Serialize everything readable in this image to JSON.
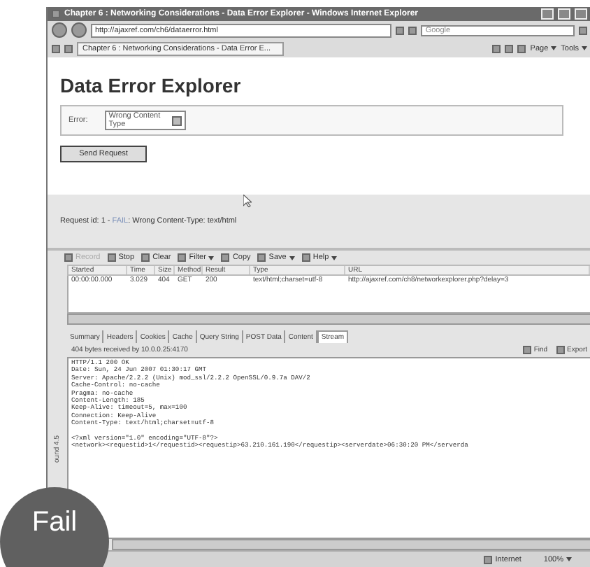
{
  "window": {
    "title": "Chapter 6 : Networking Considerations - Data Error Explorer - Windows Internet Explorer"
  },
  "address_bar": {
    "value": "http://ajaxref.com/ch6/dataerror.html"
  },
  "search": {
    "placeholder": "Google"
  },
  "browser_tab": {
    "label": "Chapter 6 : Networking Considerations - Data Error E..."
  },
  "command_bar": [
    "Page",
    "Tools"
  ],
  "page": {
    "heading": "Data Error Explorer",
    "error_label": "Error:",
    "error_value": "Wrong Content Type",
    "button": "Send Request",
    "status_prefix": "Request id: 1 - ",
    "status_fail": "FAIL",
    "status_suffix": ": Wrong Content-Type: text/html"
  },
  "fiddler": {
    "toolbar": [
      {
        "label": "Record",
        "disabled": true,
        "menu": false
      },
      {
        "label": "Stop",
        "disabled": false,
        "menu": false
      },
      {
        "label": "Clear",
        "disabled": false,
        "menu": false
      },
      {
        "label": "Filter",
        "disabled": false,
        "menu": true
      },
      {
        "label": "Copy",
        "disabled": false,
        "menu": false
      },
      {
        "label": "Save",
        "disabled": false,
        "menu": true
      },
      {
        "label": "Help",
        "disabled": false,
        "menu": true
      }
    ],
    "columns": [
      "Started",
      "Time",
      "Size",
      "Method",
      "Result",
      "Type",
      "URL"
    ],
    "rows": [
      [
        "00:00:00.000",
        "3.029",
        "404",
        "GET",
        "200",
        "text/html;charset=utf-8",
        "http://ajaxref.com/ch8/networkexplorer.php?delay=3"
      ]
    ],
    "tabs": [
      {
        "label": "Summary",
        "selected": false
      },
      {
        "label": "Headers",
        "selected": false
      },
      {
        "label": "Cookies",
        "selected": false
      },
      {
        "label": "Cache",
        "selected": false
      },
      {
        "label": "Query String",
        "selected": false
      },
      {
        "label": "POST Data",
        "selected": false
      },
      {
        "label": "Content",
        "selected": false
      },
      {
        "label": "Stream",
        "selected": true
      }
    ],
    "info": "404 bytes received by 10.0.0.25:4170",
    "actions": [
      "Find",
      "Export"
    ],
    "stream_headers": [
      "HTTP/1.1 200 OK",
      "Date: Sun, 24 Jun 2007 01:30:17 GMT",
      "Server: Apache/2.2.2 (Unix) mod_ssl/2.2.2 OpenSSL/0.9.7a DAV/2",
      "Cache-Control: no-cache",
      "Pragma: no-cache",
      "Content-Length: 185",
      "Keep-Alive: timeout=5, max=100",
      "Connection: Keep-Alive",
      "Content-Type: text/html;charset=utf-8"
    ],
    "stream_body": [
      "<?xml version=\"1.0\" encoding=\"UTF-8\"?>",
      "<network><requestid>1</requestid><requestip>63.210.161.190</requestip><serverdate>06:30:20 PM</serverda"
    ],
    "side_label": "ound 4.5"
  },
  "status_bar": {
    "zone": "Internet",
    "zoom": "100%"
  },
  "badge": "Fail"
}
